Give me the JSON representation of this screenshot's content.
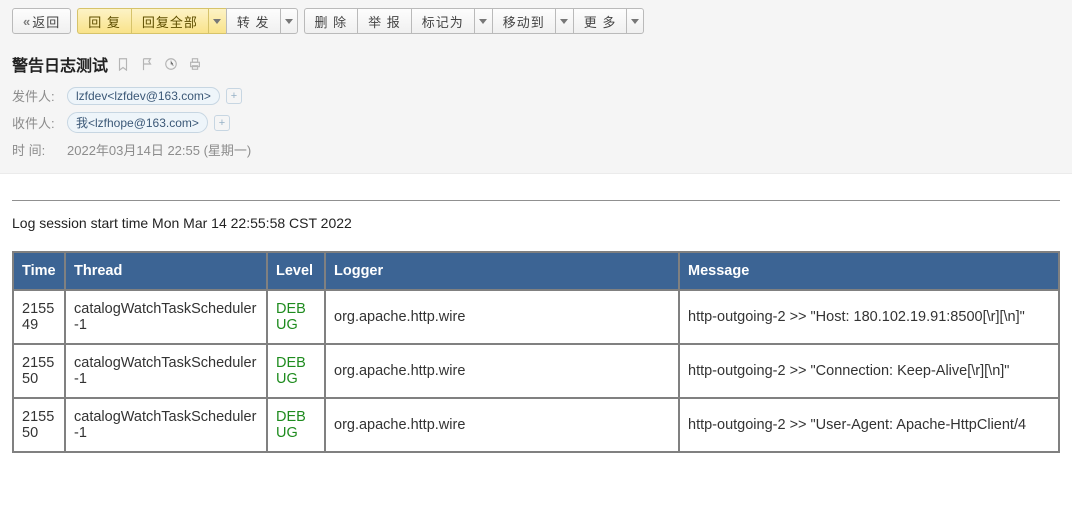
{
  "toolbar": {
    "back": "返回",
    "reply": "回 复",
    "reply_all": "回复全部",
    "forward": "转 发",
    "delete": "删 除",
    "spam": "举 报",
    "mark_as": "标记为",
    "move_to": "移动到",
    "more": "更 多"
  },
  "mail": {
    "subject": "警告日志测试",
    "from_label": "发件人:",
    "from_chip": "lzfdev<lzfdev@163.com>",
    "to_label": "收件人:",
    "to_chip": "我<lzfhope@163.com>",
    "time_label": "时   间:",
    "time_value": "2022年03月14日 22:55 (星期一)"
  },
  "log": {
    "intro": "Log session start time Mon Mar 14 22:55:58 CST 2022",
    "headers": {
      "time": "Time",
      "thread": "Thread",
      "level": "Level",
      "logger": "Logger",
      "message": "Message"
    },
    "rows": [
      {
        "time": "215549",
        "thread": "catalogWatchTaskScheduler-1",
        "level": "DEBUG",
        "logger": "org.apache.http.wire",
        "message": "http-outgoing-2 >> \"Host: 180.102.19.91:8500[\\r][\\n]\""
      },
      {
        "time": "215550",
        "thread": "catalogWatchTaskScheduler-1",
        "level": "DEBUG",
        "logger": "org.apache.http.wire",
        "message": "http-outgoing-2 >> \"Connection: Keep-Alive[\\r][\\n]\""
      },
      {
        "time": "215550",
        "thread": "catalogWatchTaskScheduler-1",
        "level": "DEBUG",
        "logger": "org.apache.http.wire",
        "message": "http-outgoing-2 >> \"User-Agent: Apache-HttpClient/4"
      }
    ]
  }
}
